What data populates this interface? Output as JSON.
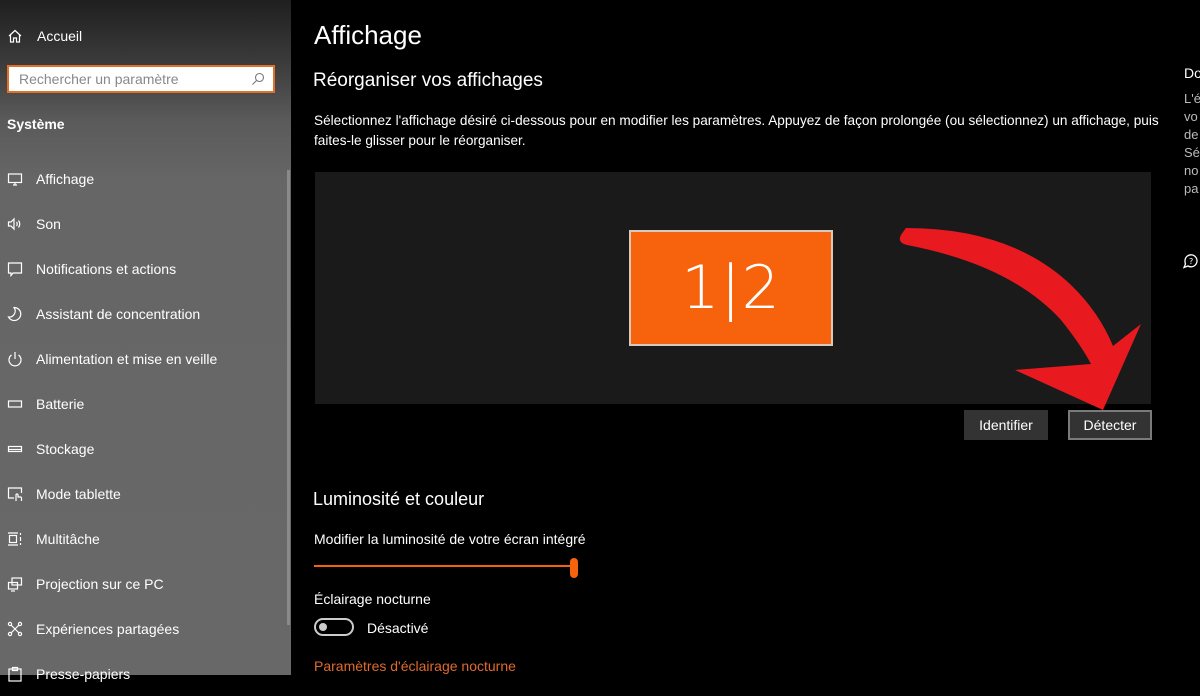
{
  "sidebar": {
    "home_label": "Accueil",
    "search_placeholder": "Rechercher un paramètre",
    "section_title": "Système",
    "items": [
      {
        "label": "Affichage",
        "icon": "monitor-icon"
      },
      {
        "label": "Son",
        "icon": "speaker-icon"
      },
      {
        "label": "Notifications et actions",
        "icon": "notification-icon"
      },
      {
        "label": "Assistant de concentration",
        "icon": "moon-icon"
      },
      {
        "label": "Alimentation et mise en veille",
        "icon": "power-icon"
      },
      {
        "label": "Batterie",
        "icon": "battery-icon"
      },
      {
        "label": "Stockage",
        "icon": "storage-icon"
      },
      {
        "label": "Mode tablette",
        "icon": "tablet-mode-icon"
      },
      {
        "label": "Multitâche",
        "icon": "multitask-icon"
      },
      {
        "label": "Projection sur ce PC",
        "icon": "projection-icon"
      },
      {
        "label": "Expériences partagées",
        "icon": "shared-experiences-icon"
      },
      {
        "label": "Presse-papiers",
        "icon": "clipboard-icon"
      }
    ]
  },
  "main": {
    "page_title": "Affichage",
    "arrange": {
      "heading": "Réorganiser vos affichages",
      "description": "Sélectionnez l'affichage désiré ci-dessous pour en modifier les paramètres. Appuyez de façon prolongée (ou sélectionnez) un affichage, puis faites-le glisser pour le réorganiser.",
      "monitor_label": "1|2",
      "identify_button": "Identifier",
      "detect_button": "Détecter"
    },
    "brightness": {
      "heading": "Luminosité et couleur",
      "slider_label": "Modifier la luminosité de votre écran intégré",
      "slider_value_percent": 100,
      "night_light_label": "Éclairage nocturne",
      "night_light_state": "Désactivé",
      "night_light_on": false,
      "night_light_settings_link": "Paramètres d'éclairage nocturne"
    }
  },
  "side_panel": {
    "title": "Do",
    "lines": [
      "L'é",
      "vo",
      "de",
      "Sé",
      "no",
      "pa"
    ]
  },
  "colors": {
    "accent": "#f7630c",
    "annotation_arrow": "#e8191f",
    "link": "#e06a2c"
  }
}
